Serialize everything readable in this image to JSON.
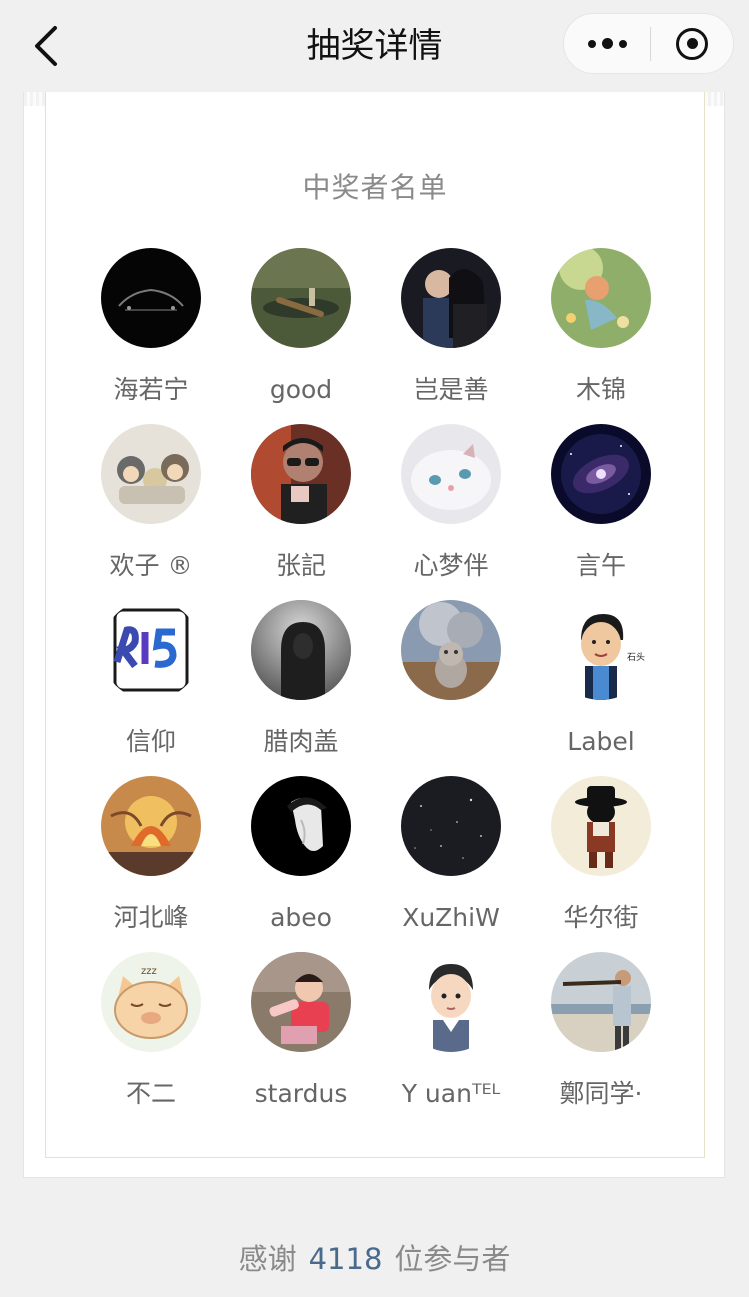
{
  "navbar": {
    "title": "抽奖详情",
    "back_icon": "chevron-left-icon",
    "more_icon": "more-dots-icon",
    "close_icon": "target-icon"
  },
  "card": {
    "title": "中奖者名单",
    "winners": [
      {
        "name": "海若宁",
        "avatar": "dark-car"
      },
      {
        "name": "good",
        "avatar": "boat-on-water"
      },
      {
        "name": "岂是善",
        "avatar": "couple-photo"
      },
      {
        "name": "木锦",
        "avatar": "girl-with-flowers"
      },
      {
        "name": "欢子 ®",
        "avatar": "cartoon-monkeys"
      },
      {
        "name": "张記",
        "avatar": "man-sunglasses"
      },
      {
        "name": "心梦伴",
        "avatar": "white-kitten"
      },
      {
        "name": "言午",
        "avatar": "galaxy"
      },
      {
        "name": "信仰",
        "avatar": "r15-phone"
      },
      {
        "name": "腊肉盖",
        "avatar": "hooded-figure"
      },
      {
        "name": "",
        "avatar": "cat-volcano"
      },
      {
        "name": "Label",
        "avatar": "cartoon-boy"
      },
      {
        "name": "河北峰",
        "avatar": "fire-painting"
      },
      {
        "name": "abeo",
        "avatar": "silhouette-hat"
      },
      {
        "name": "XuZhiW",
        "avatar": "starry-sky"
      },
      {
        "name": "华尔街",
        "avatar": "cartoon-gentleman"
      },
      {
        "name": "不二",
        "avatar": "sleepy-pig"
      },
      {
        "name": "stardus",
        "avatar": "child-photo"
      },
      {
        "name": "Y uanᵀᴱᴸ",
        "avatar": "cartoon-young-man"
      },
      {
        "name": "鄭同学·",
        "avatar": "man-at-beach"
      }
    ]
  },
  "footer": {
    "prefix": "感谢",
    "count": "4118",
    "suffix": "位参与者"
  },
  "colors": {
    "background": "#f0f0f0",
    "card": "#ffffff",
    "accent_number": "#4a6a8c",
    "gold_border": "#e8e0c8"
  }
}
